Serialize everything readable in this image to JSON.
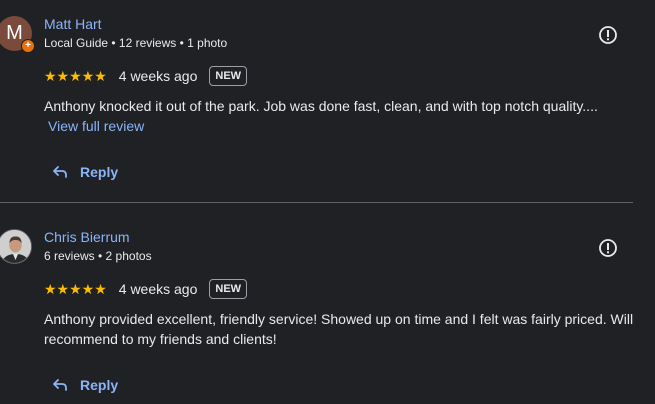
{
  "reviews": [
    {
      "name": "Matt Hart",
      "avatar_initial": "M",
      "meta": "Local Guide • 12 reviews • 1 photo",
      "stars": "★★★★★",
      "rating": 5,
      "date": "4 weeks ago",
      "badge": "NEW",
      "text": "Anthony knocked it out of the park. Job was done fast, clean, and with top notch quality....",
      "more_label": "View full review",
      "reply_label": "Reply"
    },
    {
      "name": "Chris Bierrum",
      "meta": "6 reviews • 2 photos",
      "stars": "★★★★★",
      "rating": 5,
      "date": "4 weeks ago",
      "badge": "NEW",
      "text": "Anthony provided excellent, friendly service! Showed up on time and I felt was fairly priced. Will recommend to my friends and clients!",
      "reply_label": "Reply"
    }
  ],
  "colors": {
    "background": "#202124",
    "link": "#8ab4f8",
    "star": "#fbbc04",
    "text": "#e8eaed",
    "local_guide_badge": "#e8710a"
  },
  "icons": {
    "flag": "report-flag-icon",
    "reply": "reply-arrow-icon",
    "guide": "local-guide-badge-icon"
  }
}
